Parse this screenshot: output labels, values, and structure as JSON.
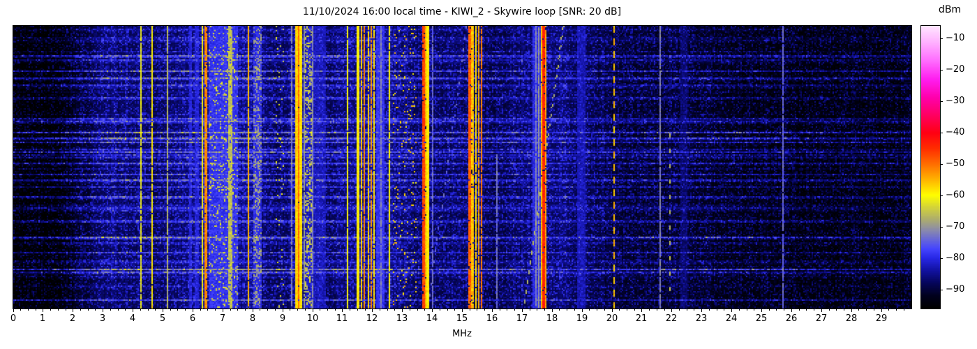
{
  "chart_data": {
    "type": "heatmap",
    "title": "11/10/2024 16:00 local time - KIWI_2 - Skywire loop [SNR: 20 dB]",
    "xlabel": "MHz",
    "x_range_mhz": [
      0,
      30
    ],
    "x_tick_labels": [
      "0",
      "1",
      "2",
      "3",
      "4",
      "5",
      "6",
      "7",
      "8",
      "9",
      "10",
      "11",
      "12",
      "13",
      "14",
      "15",
      "16",
      "17",
      "18",
      "19",
      "20",
      "21",
      "22",
      "23",
      "24",
      "25",
      "26",
      "27",
      "28",
      "29"
    ],
    "x_minor_tick_step_mhz": 0.25,
    "colorbar": {
      "label": "dBm",
      "tick_values": [
        -10,
        -20,
        -30,
        -40,
        -50,
        -60,
        -70,
        -80,
        -90
      ],
      "tick_labels": [
        "−10",
        "−20",
        "−30",
        "−40",
        "−50",
        "−60",
        "−70",
        "−80",
        "−90"
      ],
      "range_dbm": [
        -96,
        -6
      ]
    },
    "colormap_stops": [
      [
        -96,
        [
          0,
          0,
          0
        ]
      ],
      [
        -92,
        [
          1,
          1,
          30
        ]
      ],
      [
        -88,
        [
          6,
          6,
          90
        ]
      ],
      [
        -84,
        [
          18,
          18,
          160
        ]
      ],
      [
        -80,
        [
          40,
          40,
          230
        ]
      ],
      [
        -77,
        [
          70,
          70,
          255
        ]
      ],
      [
        -74,
        [
          105,
          105,
          215
        ]
      ],
      [
        -71,
        [
          140,
          140,
          170
        ]
      ],
      [
        -68,
        [
          170,
          170,
          115
        ]
      ],
      [
        -64,
        [
          210,
          210,
          60
        ]
      ],
      [
        -60,
        [
          255,
          255,
          0
        ]
      ],
      [
        -55,
        [
          255,
          180,
          0
        ]
      ],
      [
        -50,
        [
          255,
          110,
          0
        ]
      ],
      [
        -45,
        [
          255,
          45,
          0
        ]
      ],
      [
        -40,
        [
          255,
          0,
          20
        ]
      ],
      [
        -35,
        [
          255,
          0,
          90
        ]
      ],
      [
        -29,
        [
          255,
          0,
          170
        ]
      ],
      [
        -23,
        [
          255,
          30,
          240
        ]
      ],
      [
        -17,
        [
          255,
          110,
          255
        ]
      ],
      [
        -11,
        [
          255,
          180,
          255
        ]
      ],
      [
        -6,
        [
          255,
          230,
          255
        ]
      ]
    ],
    "noise": {
      "seed": 1337,
      "base_profile_mhz_dbm": [
        [
          0,
          -94.5
        ],
        [
          1.6,
          -94
        ],
        [
          2.1,
          -90.5
        ],
        [
          2.6,
          -88
        ],
        [
          3.1,
          -86
        ],
        [
          3.8,
          -86
        ],
        [
          4.6,
          -86.5
        ],
        [
          5.4,
          -86
        ],
        [
          6.2,
          -84.5
        ],
        [
          7.0,
          -84
        ],
        [
          7.8,
          -84.5
        ],
        [
          8.5,
          -86.5
        ],
        [
          9.0,
          -87
        ],
        [
          9.4,
          -85
        ],
        [
          10.1,
          -85.5
        ],
        [
          10.6,
          -86.5
        ],
        [
          11.2,
          -85
        ],
        [
          11.9,
          -84
        ],
        [
          12.5,
          -84.5
        ],
        [
          13.2,
          -86
        ],
        [
          14.0,
          -87
        ],
        [
          15.0,
          -87
        ],
        [
          16.0,
          -88
        ],
        [
          16.8,
          -86.5
        ],
        [
          17.5,
          -85.5
        ],
        [
          18.4,
          -86
        ],
        [
          19.2,
          -87.5
        ],
        [
          20.1,
          -89
        ],
        [
          21.0,
          -90
        ],
        [
          22.0,
          -89.5
        ],
        [
          23.0,
          -90.5
        ],
        [
          24.0,
          -91.5
        ],
        [
          25.0,
          -92
        ],
        [
          26.5,
          -92.5
        ],
        [
          28.0,
          -92.5
        ],
        [
          30,
          -93
        ]
      ],
      "streak_count": 48,
      "streak_amp_db": [
        2,
        14
      ],
      "minor_streak_count": 14
    },
    "signals": [
      {
        "f0": 4.26,
        "f1": 4.31,
        "level": -62,
        "type": "line"
      },
      {
        "f0": 4.63,
        "f1": 4.68,
        "level": -59,
        "type": "line"
      },
      {
        "f0": 5.12,
        "f1": 5.16,
        "level": -67,
        "type": "line"
      },
      {
        "f0": 5.86,
        "f1": 5.95,
        "level": -81,
        "type": "band"
      },
      {
        "f0": 6.05,
        "f1": 6.22,
        "level": -81,
        "type": "band"
      },
      {
        "f0": 6.28,
        "f1": 6.34,
        "level": -61,
        "type": "line"
      },
      {
        "f0": 6.41,
        "f1": 6.49,
        "level": -52,
        "type": "line"
      },
      {
        "f0": 6.55,
        "f1": 7.5,
        "level": -79,
        "type": "band"
      },
      {
        "f0": 6.55,
        "f1": 7.5,
        "level": -64,
        "type": "speckle",
        "p": 0.1
      },
      {
        "f0": 7.2,
        "f1": 7.31,
        "level": -66,
        "type": "line",
        "gap": 0.2
      },
      {
        "f0": 7.84,
        "f1": 7.88,
        "level": -55,
        "type": "line"
      },
      {
        "f0": 8.0,
        "f1": 8.32,
        "level": -80,
        "type": "band"
      },
      {
        "f0": 8.0,
        "f1": 8.32,
        "level": -69,
        "type": "speckle",
        "p": 0.35
      },
      {
        "f0": 8.78,
        "f1": 9.05,
        "level": -63,
        "type": "speckle",
        "p": 0.06
      },
      {
        "f0": 9.26,
        "f1": 9.31,
        "level": -72,
        "type": "line"
      },
      {
        "f0": 9.41,
        "f1": 9.53,
        "level": -57,
        "type": "band"
      },
      {
        "f0": 9.53,
        "f1": 9.56,
        "level": -50,
        "type": "line"
      },
      {
        "f0": 9.57,
        "f1": 9.64,
        "level": -58,
        "type": "band"
      },
      {
        "f0": 9.68,
        "f1": 9.73,
        "level": -70,
        "type": "line"
      },
      {
        "f0": 9.76,
        "f1": 9.97,
        "level": -65,
        "type": "speckle",
        "p": 0.3
      },
      {
        "f0": 9.76,
        "f1": 10.45,
        "level": -83,
        "type": "band"
      },
      {
        "f0": 10.0,
        "f1": 10.04,
        "level": -71,
        "type": "line"
      },
      {
        "f0": 11.13,
        "f1": 11.17,
        "level": -61,
        "type": "line"
      },
      {
        "f0": 11.45,
        "f1": 11.56,
        "level": -59,
        "type": "band"
      },
      {
        "f0": 11.59,
        "f1": 11.64,
        "level": -57,
        "type": "line"
      },
      {
        "f0": 11.7,
        "f1": 11.77,
        "level": -52,
        "type": "line"
      },
      {
        "f0": 11.83,
        "f1": 11.9,
        "level": -57,
        "type": "line"
      },
      {
        "f0": 11.92,
        "f1": 11.99,
        "level": -53,
        "type": "line"
      },
      {
        "f0": 12.02,
        "f1": 12.09,
        "level": -58,
        "type": "line"
      },
      {
        "f0": 12.1,
        "f1": 12.42,
        "level": -79,
        "type": "band"
      },
      {
        "f0": 12.28,
        "f1": 12.32,
        "level": -72,
        "type": "line"
      },
      {
        "f0": 12.52,
        "f1": 12.57,
        "level": -60,
        "type": "line"
      },
      {
        "f0": 12.7,
        "f1": 13.45,
        "level": -57,
        "type": "speckle",
        "p": 0.04
      },
      {
        "f0": 13.66,
        "f1": 13.73,
        "level": -47,
        "type": "line"
      },
      {
        "f0": 13.74,
        "f1": 13.81,
        "level": -55,
        "type": "line"
      },
      {
        "f0": 13.82,
        "f1": 13.91,
        "level": -59,
        "type": "band"
      },
      {
        "f0": 14.0,
        "f1": 14.04,
        "level": -74,
        "type": "line"
      },
      {
        "f0": 15.22,
        "f1": 15.28,
        "level": -49,
        "type": "line"
      },
      {
        "f0": 15.31,
        "f1": 15.37,
        "level": -56,
        "type": "line"
      },
      {
        "f0": 15.42,
        "f1": 15.49,
        "level": -58,
        "type": "line"
      },
      {
        "f0": 15.52,
        "f1": 15.58,
        "level": -54,
        "type": "line"
      },
      {
        "f0": 15.6,
        "f1": 15.65,
        "level": -51,
        "type": "line"
      },
      {
        "f0": 16.13,
        "f1": 16.18,
        "level": -73,
        "type": "line",
        "ymin": 0.45
      },
      {
        "f0": 17.35,
        "f1": 17.62,
        "level": -80,
        "type": "band"
      },
      {
        "f0": 17.42,
        "f1": 17.46,
        "level": -72,
        "type": "line"
      },
      {
        "f0": 17.52,
        "f1": 17.56,
        "level": -70,
        "type": "line"
      },
      {
        "f0": 17.63,
        "f1": 17.68,
        "level": -56,
        "type": "line"
      },
      {
        "f0": 17.68,
        "f1": 17.77,
        "level": -44,
        "type": "line"
      },
      {
        "f0": 17.77,
        "f1": 17.81,
        "level": -54,
        "type": "line"
      },
      {
        "f0": 18.85,
        "f1": 19.12,
        "level": -83,
        "type": "band"
      },
      {
        "f0": 20.05,
        "f1": 20.11,
        "level": -56,
        "type": "dash",
        "dash": [
          5,
          4
        ]
      },
      {
        "f0": 21.58,
        "f1": 21.62,
        "level": -72,
        "type": "line"
      },
      {
        "f0": 21.92,
        "f1": 21.98,
        "level": -66,
        "type": "dash",
        "dash": [
          3,
          8
        ],
        "ymin": 0.35,
        "ymax": 0.95
      },
      {
        "f0": 22.3,
        "f1": 22.52,
        "level": -87,
        "type": "band"
      },
      {
        "f0": 25.68,
        "f1": 25.72,
        "level": -74,
        "type": "line"
      }
    ],
    "chirps": [
      {
        "f_top": 18.35,
        "f_bottom": 17.02,
        "level": -67,
        "dash": [
          3,
          4
        ]
      },
      {
        "f_top": 15.12,
        "f_bottom": 13.82,
        "level": -74,
        "dash": [
          2,
          6
        ]
      }
    ]
  }
}
